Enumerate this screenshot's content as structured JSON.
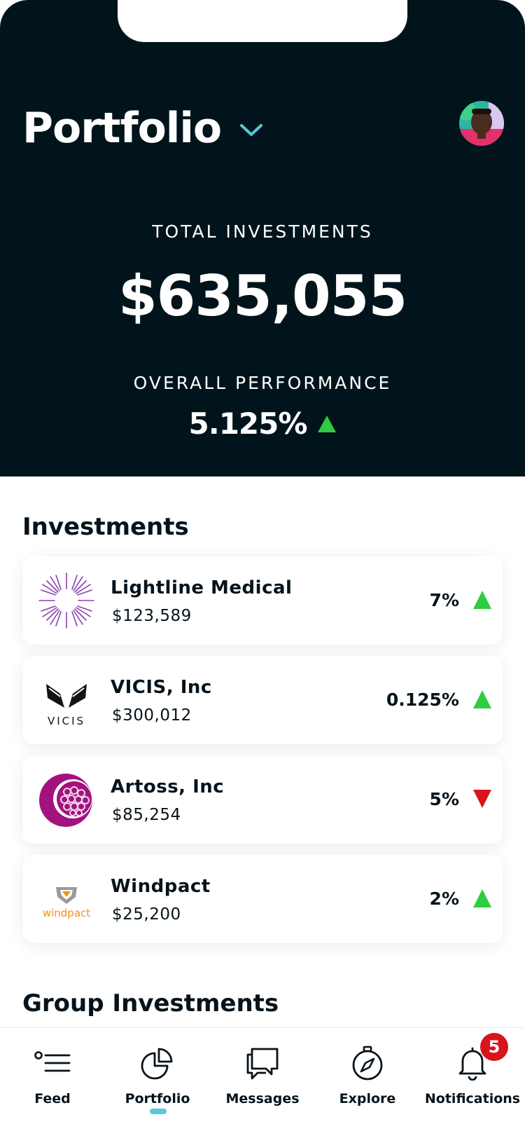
{
  "header": {
    "title": "Portfolio",
    "total_label": "TOTAL INVESTMENTS",
    "total_value": "$635,055",
    "performance_label": "OVERALL PERFORMANCE",
    "performance_value": "5.125%",
    "performance_trend": "up"
  },
  "investments": {
    "section_title": "Investments",
    "items": [
      {
        "name": "Lightline Medical",
        "amount": "$123,589",
        "change": "7%",
        "trend": "up",
        "logo": "starburst-logo"
      },
      {
        "name": "VICIS, Inc",
        "amount": "$300,012",
        "change": "0.125%",
        "trend": "up",
        "logo": "vicis-logo",
        "logo_text": "VICIS"
      },
      {
        "name": "Artoss, Inc",
        "amount": "$85,254",
        "change": "5%",
        "trend": "down",
        "logo": "artoss-logo"
      },
      {
        "name": "Windpact",
        "amount": "$25,200",
        "change": "2%",
        "trend": "up",
        "logo": "windpact-logo",
        "logo_text": "windpact"
      }
    ]
  },
  "group_investments": {
    "section_title": "Group Investments"
  },
  "tabbar": {
    "tabs": [
      {
        "label": "Feed",
        "icon": "feed-icon"
      },
      {
        "label": "Portfolio",
        "icon": "pie-chart-icon",
        "active": true
      },
      {
        "label": "Messages",
        "icon": "chat-bubbles-icon"
      },
      {
        "label": "Explore",
        "icon": "compass-icon"
      },
      {
        "label": "Notifications",
        "icon": "bell-icon"
      }
    ],
    "notification_count": "5"
  },
  "colors": {
    "header_bg": "#02141b",
    "accent": "#5ac7d6",
    "up": "#2ecc40",
    "down": "#d8141c",
    "badge": "#d8141c"
  }
}
